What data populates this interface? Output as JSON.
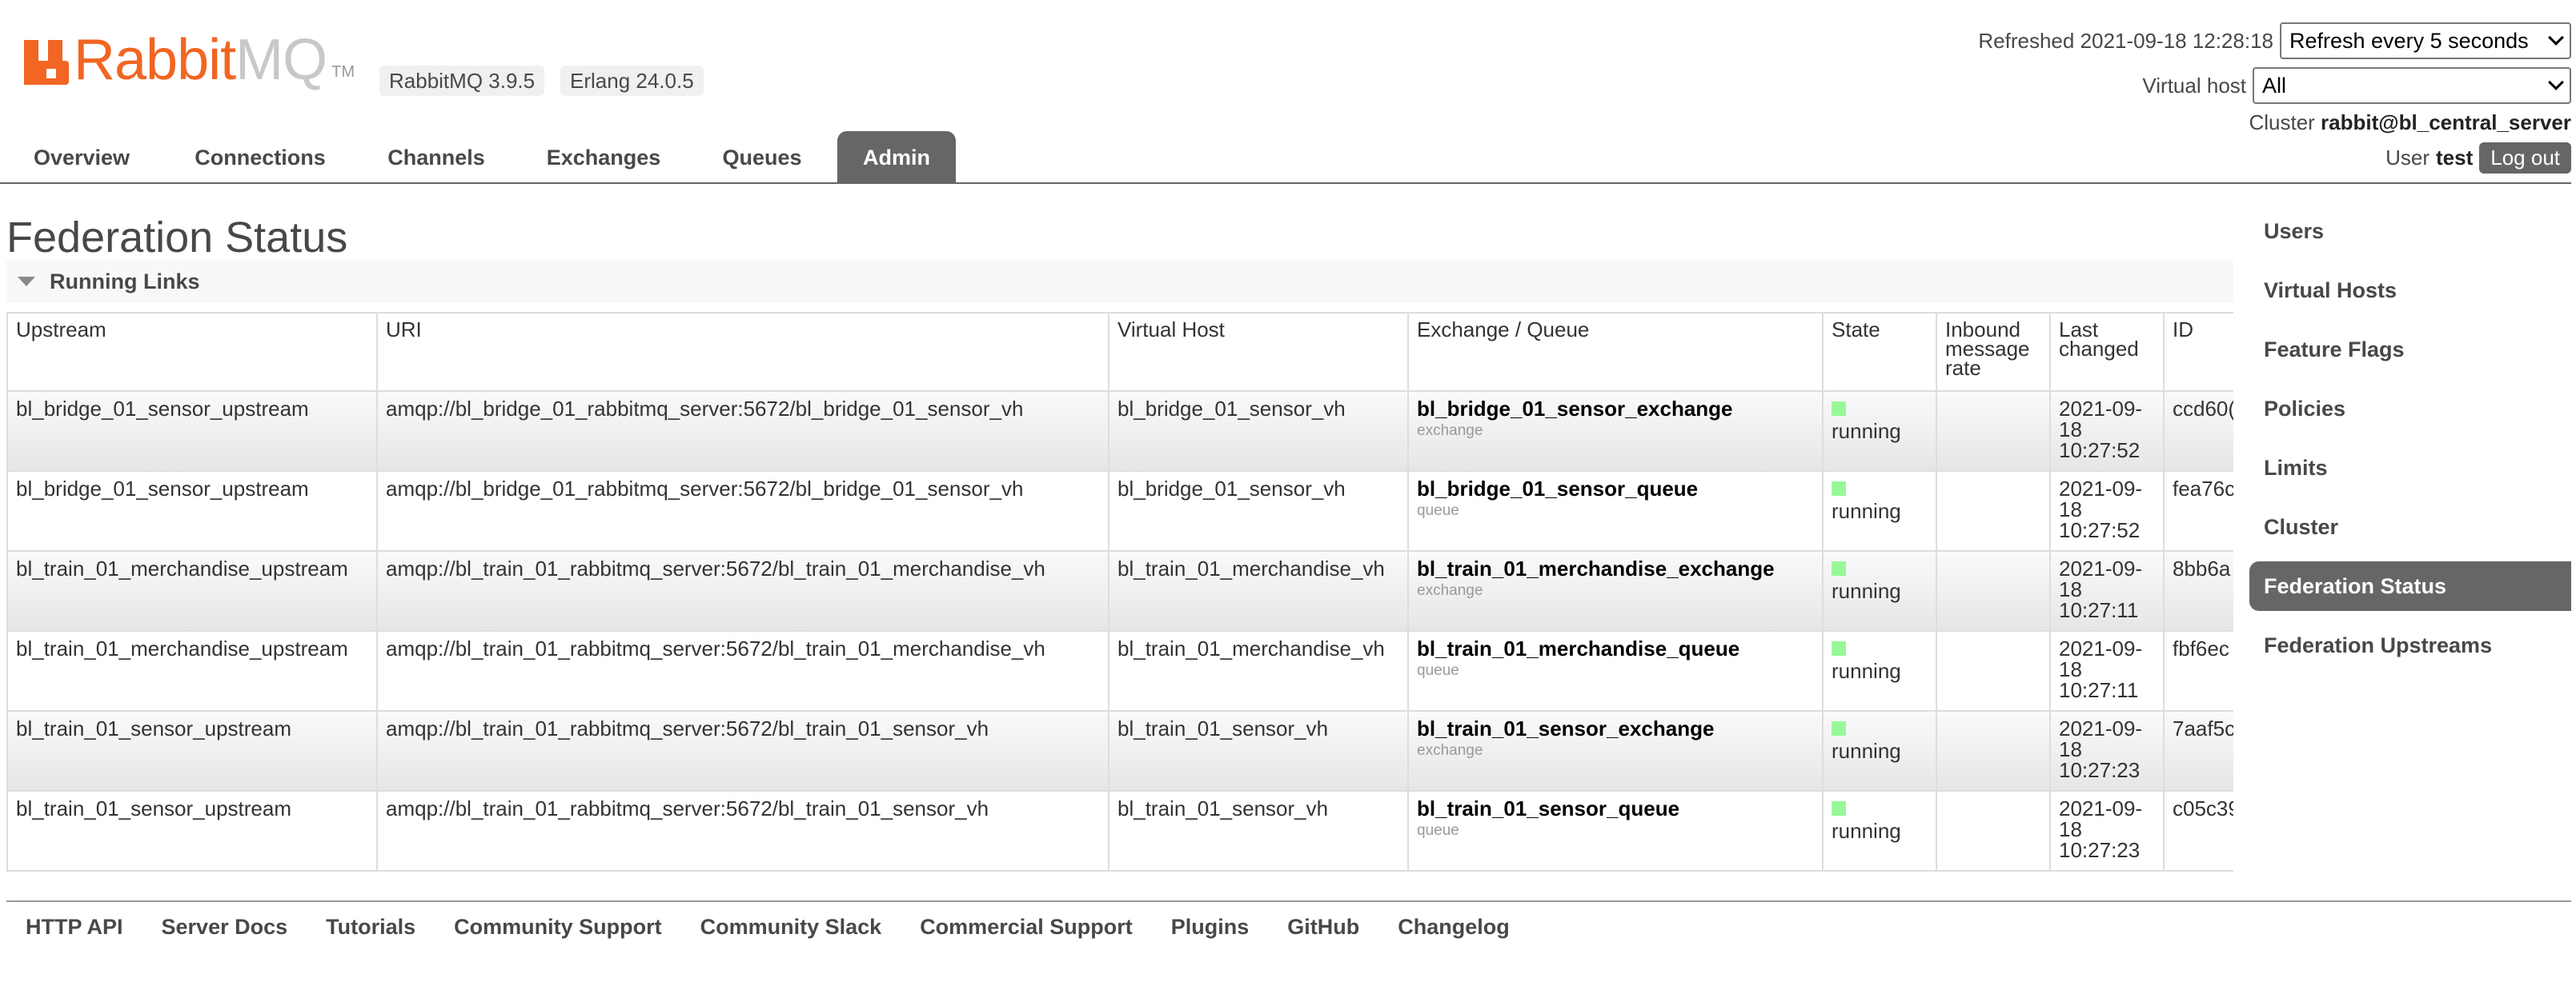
{
  "header": {
    "logo_text_main": "Rabbit",
    "logo_text_mq": "MQ",
    "logo_tm": "TM",
    "rabbitmq_version": "RabbitMQ 3.9.5",
    "erlang_version": "Erlang 24.0.5",
    "refreshed_label": "Refreshed 2021-09-18 12:28:18",
    "refresh_select": "Refresh every 5 seconds",
    "vhost_label": "Virtual host",
    "vhost_select": "All",
    "cluster_label": "Cluster",
    "cluster_name": "rabbit@bl_central_server",
    "user_label": "User",
    "user_name": "test",
    "logout_label": "Log out"
  },
  "tabs": [
    "Overview",
    "Connections",
    "Channels",
    "Exchanges",
    "Queues",
    "Admin"
  ],
  "active_tab": "Admin",
  "page_title": "Federation Status",
  "section_title": "Running Links",
  "table": {
    "headers": [
      "Upstream",
      "URI",
      "Virtual Host",
      "Exchange / Queue",
      "State",
      "Inbound message rate",
      "Last changed",
      "ID"
    ],
    "rows": [
      {
        "upstream": "bl_bridge_01_sensor_upstream",
        "uri": "amqp://bl_bridge_01_rabbitmq_server:5672/bl_bridge_01_sensor_vh",
        "vhost": "bl_bridge_01_sensor_vh",
        "name": "bl_bridge_01_sensor_exchange",
        "type": "exchange",
        "state": "running",
        "rate": "",
        "changed_1": "2021-09-",
        "changed_2": "18",
        "changed_3": "10:27:52",
        "id": "ccd60("
      },
      {
        "upstream": "bl_bridge_01_sensor_upstream",
        "uri": "amqp://bl_bridge_01_rabbitmq_server:5672/bl_bridge_01_sensor_vh",
        "vhost": "bl_bridge_01_sensor_vh",
        "name": "bl_bridge_01_sensor_queue",
        "type": "queue",
        "state": "running",
        "rate": "",
        "changed_1": "2021-09-",
        "changed_2": "18",
        "changed_3": "10:27:52",
        "id": "fea76c"
      },
      {
        "upstream": "bl_train_01_merchandise_upstream",
        "uri": "amqp://bl_train_01_rabbitmq_server:5672/bl_train_01_merchandise_vh",
        "vhost": "bl_train_01_merchandise_vh",
        "name": "bl_train_01_merchandise_exchange",
        "type": "exchange",
        "state": "running",
        "rate": "",
        "changed_1": "2021-09-",
        "changed_2": "18",
        "changed_3": "10:27:11",
        "id": "8bb6a"
      },
      {
        "upstream": "bl_train_01_merchandise_upstream",
        "uri": "amqp://bl_train_01_rabbitmq_server:5672/bl_train_01_merchandise_vh",
        "vhost": "bl_train_01_merchandise_vh",
        "name": "bl_train_01_merchandise_queue",
        "type": "queue",
        "state": "running",
        "rate": "",
        "changed_1": "2021-09-",
        "changed_2": "18",
        "changed_3": "10:27:11",
        "id": "fbf6ec"
      },
      {
        "upstream": "bl_train_01_sensor_upstream",
        "uri": "amqp://bl_train_01_rabbitmq_server:5672/bl_train_01_sensor_vh",
        "vhost": "bl_train_01_sensor_vh",
        "name": "bl_train_01_sensor_exchange",
        "type": "exchange",
        "state": "running",
        "rate": "",
        "changed_1": "2021-09-",
        "changed_2": "18",
        "changed_3": "10:27:23",
        "id": "7aaf5c"
      },
      {
        "upstream": "bl_train_01_sensor_upstream",
        "uri": "amqp://bl_train_01_rabbitmq_server:5672/bl_train_01_sensor_vh",
        "vhost": "bl_train_01_sensor_vh",
        "name": "bl_train_01_sensor_queue",
        "type": "queue",
        "state": "running",
        "rate": "",
        "changed_1": "2021-09-",
        "changed_2": "18",
        "changed_3": "10:27:23",
        "id": "c05c39"
      }
    ]
  },
  "sidebar": [
    "Users",
    "Virtual Hosts",
    "Feature Flags",
    "Policies",
    "Limits",
    "Cluster",
    "Federation Status",
    "Federation Upstreams"
  ],
  "sidebar_active": "Federation Status",
  "footer": [
    "HTTP API",
    "Server Docs",
    "Tutorials",
    "Community Support",
    "Community Slack",
    "Commercial Support",
    "Plugins",
    "GitHub",
    "Changelog"
  ],
  "colors": {
    "brand_orange": "#f26522",
    "tab_active": "#666666",
    "state_running": "#98f898"
  }
}
